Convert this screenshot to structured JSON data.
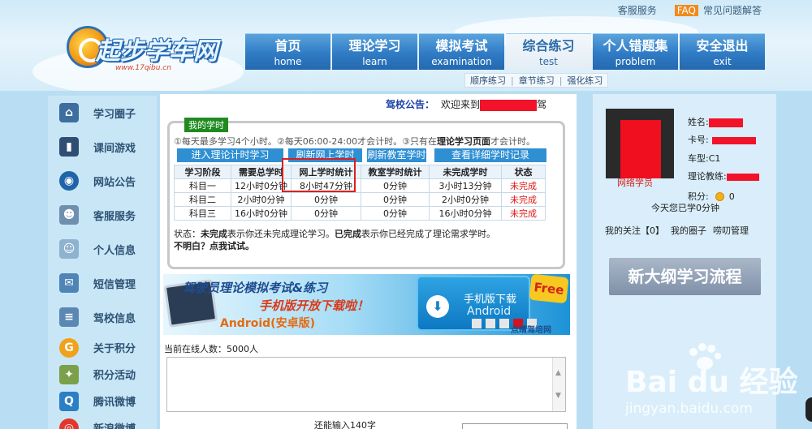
{
  "header": {
    "top_links": {
      "service": "客服服务",
      "faq_badge": "FAQ",
      "faq": "常见问题解答"
    },
    "logo": {
      "title": "起步学车网",
      "url": "www.17qibu.cn"
    },
    "nav": [
      {
        "zh": "首页",
        "en": "home"
      },
      {
        "zh": "理论学习",
        "en": "learn"
      },
      {
        "zh": "模拟考试",
        "en": "examination"
      },
      {
        "zh": "综合练习",
        "en": "test"
      },
      {
        "zh": "个人错题集",
        "en": "problem"
      },
      {
        "zh": "安全退出",
        "en": "exit"
      }
    ],
    "subnav": [
      "顺序练习",
      "章节练习",
      "强化练习"
    ]
  },
  "sidebar": {
    "items": [
      {
        "label": "学习圈子",
        "icon": "house-icon"
      },
      {
        "label": "课间游戏",
        "icon": "game-icon"
      },
      {
        "label": "网站公告",
        "icon": "globe-icon"
      },
      {
        "label": "客服服务",
        "icon": "service-user-icon"
      },
      {
        "label": "个人信息",
        "icon": "profile-icon"
      },
      {
        "label": "短信管理",
        "icon": "envelope-icon"
      },
      {
        "label": "驾校信息",
        "icon": "school-info-icon"
      },
      {
        "label": "关于积分",
        "icon": "points-icon"
      },
      {
        "label": "积分活动",
        "icon": "activity-icon"
      },
      {
        "label": "腾讯微博",
        "icon": "tencent-weibo-icon"
      },
      {
        "label": "新浪微博",
        "icon": "sina-weibo-icon"
      }
    ]
  },
  "main": {
    "notice": {
      "label": "驾校公告：",
      "text": "欢迎来到",
      "tail": "驾"
    },
    "study": {
      "tag": "我的学时",
      "rules": {
        "p1": "①每天最多学习4个小时。②每天06:00-24:00才会计时。③只有在",
        "bold": "理论学习页面",
        "p2": "才会计时。"
      },
      "buttons": [
        "进入理论计时学习",
        "刷新网上学时",
        "刷新教室学时",
        "查看详细学时记录"
      ],
      "columns": [
        "学习阶段",
        "需要总学时",
        "网上学时统计",
        "教室学时统计",
        "未完成学时",
        "状态"
      ],
      "rows": [
        [
          "科目一",
          "12小时0分钟",
          "8小时47分钟",
          "0分钟",
          "3小时13分钟",
          "未完成"
        ],
        [
          "科目二",
          "2小时0分钟",
          "0分钟",
          "0分钟",
          "2小时0分钟",
          "未完成"
        ],
        [
          "科目三",
          "16小时0分钟",
          "0分钟",
          "0分钟",
          "16小时0分钟",
          "未完成"
        ]
      ],
      "status_note": {
        "prefix": "状态：",
        "b1": "未完成",
        "t1": "表示你还未完成理论学习。",
        "b2": "已完成",
        "t2": "表示你已经完成了理论需求学时。",
        "line2": "不明白？点我试试。"
      }
    },
    "banner": {
      "line1": "驾驶员理论模拟考试&练习",
      "line2": "手机版开放下载啦！",
      "line3": "Android(安卓版)",
      "download": "手机版下载",
      "android": "Android",
      "free": "Free",
      "brand": "点睛驾培网",
      "active_slide": 4,
      "slide_count": 5
    },
    "online": "当前在线人数：5000人",
    "chat_footer": "还能输入140字"
  },
  "right": {
    "avatar_label": "网络学员",
    "name_label": "姓名:",
    "card_label": "卡号:",
    "car_type_label": "车型:",
    "car_type": "C1",
    "coach_label": "理论教练:",
    "points_label": "积分:",
    "points": "0",
    "today": "今天您已学0分钟",
    "links": [
      "我的关注【0】",
      "我的圈子",
      "唠叨管理"
    ],
    "flow_button": "新大纲学习流程"
  },
  "watermark": {
    "main": "Bai du 经验",
    "url": "jingyan.baidu.com"
  }
}
